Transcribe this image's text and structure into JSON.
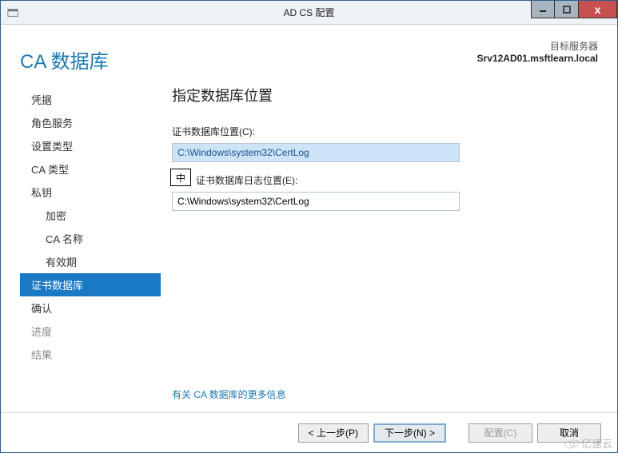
{
  "titlebar": {
    "title": "AD CS 配置"
  },
  "header": {
    "heading": "CA 数据库",
    "target_label": "目标服务器",
    "target_name": "Srv12AD01.msftlearn.local"
  },
  "sidebar": {
    "items": [
      {
        "label": "凭据",
        "type": "item"
      },
      {
        "label": "角色服务",
        "type": "item"
      },
      {
        "label": "设置类型",
        "type": "item"
      },
      {
        "label": "CA 类型",
        "type": "item"
      },
      {
        "label": "私钥",
        "type": "item"
      },
      {
        "label": "加密",
        "type": "sub"
      },
      {
        "label": "CA 名称",
        "type": "sub"
      },
      {
        "label": "有效期",
        "type": "sub"
      },
      {
        "label": "证书数据库",
        "type": "active"
      },
      {
        "label": "确认",
        "type": "item"
      },
      {
        "label": "进度",
        "type": "dim"
      },
      {
        "label": "结果",
        "type": "dim"
      }
    ]
  },
  "main": {
    "section_title": "指定数据库位置",
    "db_location_label": "证书数据库位置(C):",
    "db_location_value": "C:\\Windows\\system32\\CertLog",
    "log_location_label": "证书数据库日志位置(E):",
    "log_location_value": "C:\\Windows\\system32\\CertLog",
    "ime_text": "中",
    "more_info_link": "有关 CA 数据库的更多信息"
  },
  "footer": {
    "prev": "< 上一步(P)",
    "next": "下一步(N) >",
    "configure": "配置(C)",
    "cancel": "取消"
  },
  "watermark": {
    "text": "亿速云"
  }
}
